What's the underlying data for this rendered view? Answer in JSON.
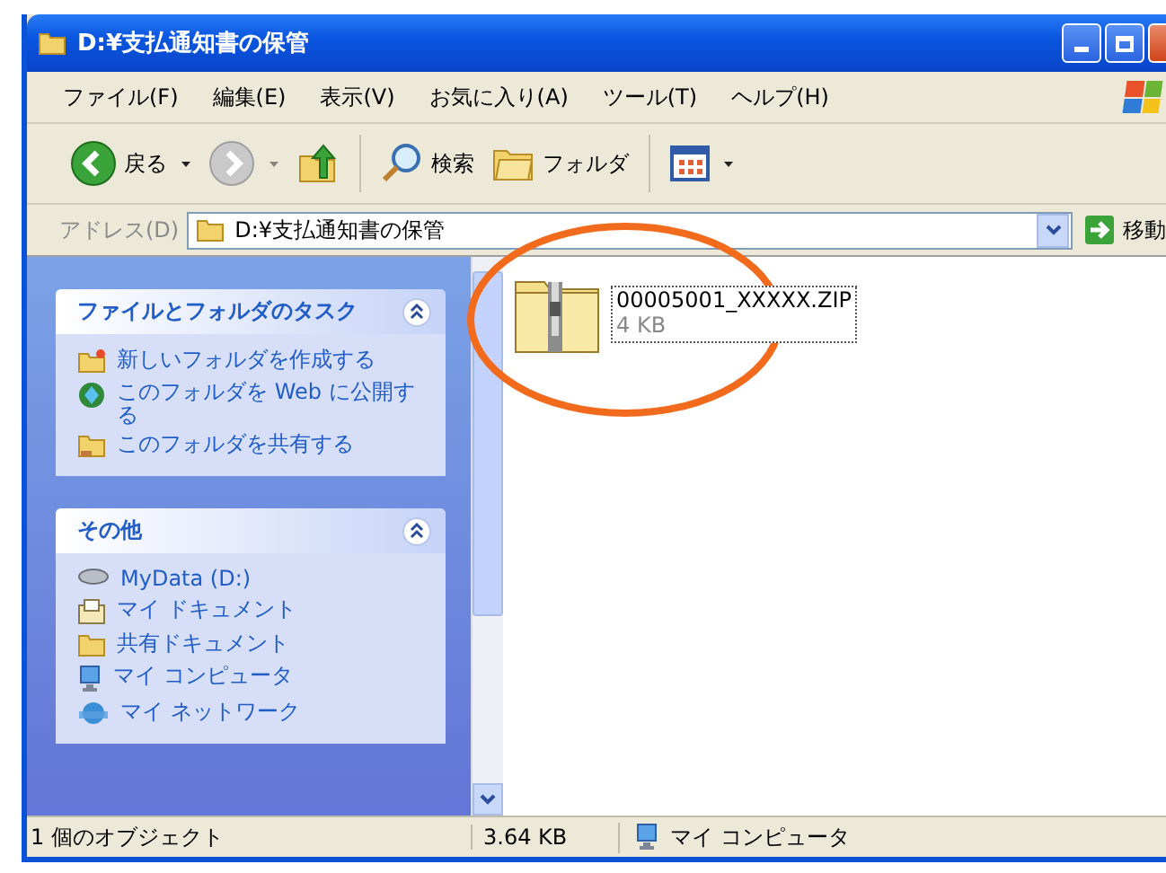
{
  "window": {
    "title": "D:¥支払通知書の保管"
  },
  "menu": [
    "ファイル(F)",
    "編集(E)",
    "表示(V)",
    "お気に入り(A)",
    "ツール(T)",
    "ヘルプ(H)"
  ],
  "toolbar": [
    {
      "kind": "back",
      "label": "戻る"
    },
    {
      "kind": "forward"
    },
    {
      "kind": "up"
    },
    {
      "kind": "search",
      "label": "検索"
    },
    {
      "kind": "folders",
      "label": "フォルダ"
    },
    {
      "kind": "views"
    }
  ],
  "address": {
    "label": "アドレス(D)",
    "value": "D:¥支払通知書の保管",
    "go": "移動"
  },
  "task_panels": [
    {
      "title": "ファイルとフォルダのタスク",
      "expanded": true,
      "items": [
        {
          "label": "新しいフォルダを作成する"
        },
        {
          "label": "このフォルダを Web に公開する"
        },
        {
          "label": "このフォルダを共有する"
        }
      ]
    },
    {
      "title": "その他",
      "expanded": true,
      "items": [
        {
          "label": "MyData (D:)"
        },
        {
          "label": "マイ ドキュメント"
        },
        {
          "label": "共有ドキュメント"
        },
        {
          "label": "マイ コンピュータ"
        },
        {
          "label": "マイ ネットワーク"
        }
      ]
    }
  ],
  "files": [
    {
      "name": "00005001_XXXXX.ZIP",
      "size": "4 KB",
      "selected": true
    }
  ],
  "status_bar": {
    "objects": "1 個のオブジェクト",
    "size": "3.64 KB",
    "zone": "マイ コンピュータ"
  }
}
